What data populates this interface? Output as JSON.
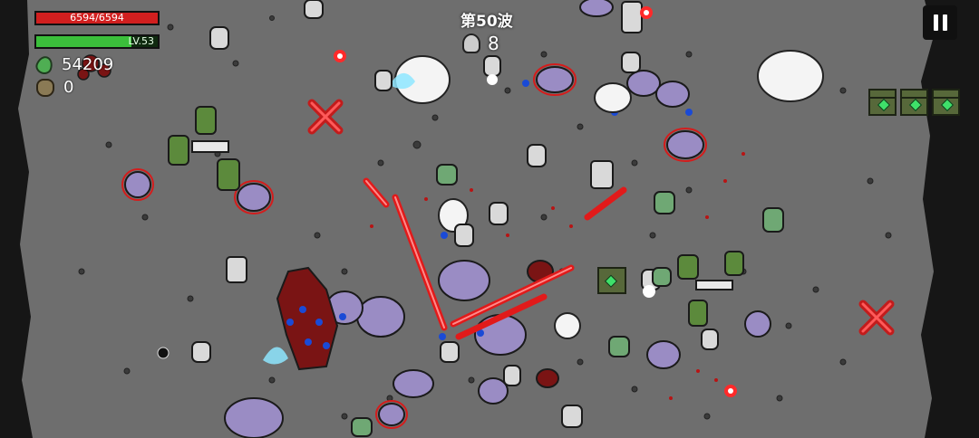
{
  "hud": {
    "hp_text": "6594/6594",
    "hp_fraction": 1.0,
    "level_text": "LV.53",
    "xp_fraction": 0.78,
    "gems": "54209",
    "bag": "0",
    "wave": "第50波",
    "kills": "8"
  },
  "icons": {
    "gem": "green-gem-icon",
    "bag": "material-bag-icon",
    "kills": "skull-icon",
    "pause": "pause-icon",
    "crate": "supply-crate-icon"
  },
  "colors": {
    "hp": "#d11f1f",
    "xp": "#3bbf3b",
    "arena": "#6f6f6f",
    "blood": "#c01818",
    "enemy": "#9a8cc4"
  }
}
